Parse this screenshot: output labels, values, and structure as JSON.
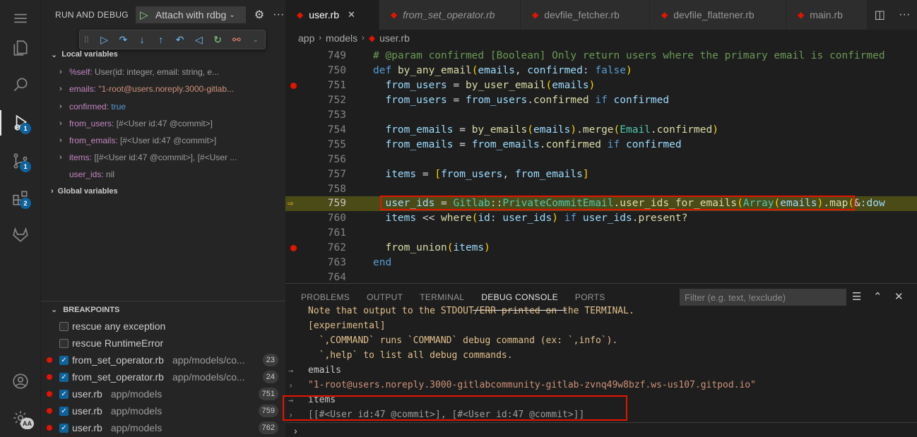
{
  "sidebar": {
    "title": "RUN AND DEBUG",
    "config": "Attach with rdbg",
    "local_title": "Local variables",
    "global_title": "Global variables",
    "variables": [
      {
        "name": "%self:",
        "value": "User(id: integer, email: string, e...",
        "kind": "plain"
      },
      {
        "name": "emails:",
        "value": "\"1-root@users.noreply.3000-gitlab...",
        "kind": "string"
      },
      {
        "name": "confirmed:",
        "value": "true",
        "kind": "bool"
      },
      {
        "name": "from_users:",
        "value": "[#<User id:47 @commit>]",
        "kind": "plain"
      },
      {
        "name": "from_emails:",
        "value": "[#<User id:47 @commit>]",
        "kind": "plain"
      },
      {
        "name": "items:",
        "value": "[[#<User id:47 @commit>], [#<User ...",
        "kind": "plain"
      },
      {
        "name": "user_ids:",
        "value": "nil",
        "kind": "plain"
      }
    ],
    "breakpoints_title": "BREAKPOINTS",
    "breakpoints": [
      {
        "name": "rescue any exception",
        "path": "",
        "line": "",
        "checked": false,
        "dot": false
      },
      {
        "name": "rescue RuntimeError",
        "path": "",
        "line": "",
        "checked": false,
        "dot": false
      },
      {
        "name": "from_set_operator.rb",
        "path": "app/models/co...",
        "line": "23",
        "checked": true,
        "dot": true
      },
      {
        "name": "from_set_operator.rb",
        "path": "app/models/co...",
        "line": "24",
        "checked": true,
        "dot": true
      },
      {
        "name": "user.rb",
        "path": "app/models",
        "line": "751",
        "checked": true,
        "dot": true
      },
      {
        "name": "user.rb",
        "path": "app/models",
        "line": "759",
        "checked": true,
        "dot": true
      },
      {
        "name": "user.rb",
        "path": "app/models",
        "line": "762",
        "checked": true,
        "dot": true
      }
    ]
  },
  "activity": {
    "badges": {
      "debug": "1",
      "scm": "1",
      "extensions": "2",
      "account": "AA"
    }
  },
  "tabs": [
    {
      "label": "user.rb",
      "active": true,
      "italic": false
    },
    {
      "label": "from_set_operator.rb",
      "active": false,
      "italic": true
    },
    {
      "label": "devfile_fetcher.rb",
      "active": false,
      "italic": false
    },
    {
      "label": "devfile_flattener.rb",
      "active": false,
      "italic": false
    },
    {
      "label": "main.rb",
      "active": false,
      "italic": false
    }
  ],
  "breadcrumb": [
    "app",
    "models",
    "user.rb"
  ],
  "code": {
    "lines": [
      "749",
      "750",
      "751",
      "752",
      "753",
      "754",
      "755",
      "756",
      "757",
      "758",
      "759",
      "760",
      "761",
      "762",
      "763",
      "764"
    ],
    "current_line": "759"
  },
  "panel": {
    "tabs": [
      "PROBLEMS",
      "OUTPUT",
      "TERMINAL",
      "DEBUG CONSOLE",
      "PORTS"
    ],
    "active_tab": "DEBUG CONSOLE",
    "filter_placeholder": "Filter (e.g. text, !exclude)",
    "console": {
      "l0": "Note that output to the STDOUT/ERR printed on the TERMINAL.",
      "l1": "[experimental]",
      "l2": "  `,COMMAND` runs `COMMAND` debug command (ex: `,info`).",
      "l3": "  `,help` to list all debug commands.",
      "l4": "emails",
      "l5": "\"1-root@users.noreply.3000-gitlabcommunity-gitlab-zvnq49w8bzf.ws-us107.gitpod.io\"",
      "l6": "items",
      "l7": "[[#<User id:47 @commit>], [#<User id:47 @commit>]]"
    }
  }
}
